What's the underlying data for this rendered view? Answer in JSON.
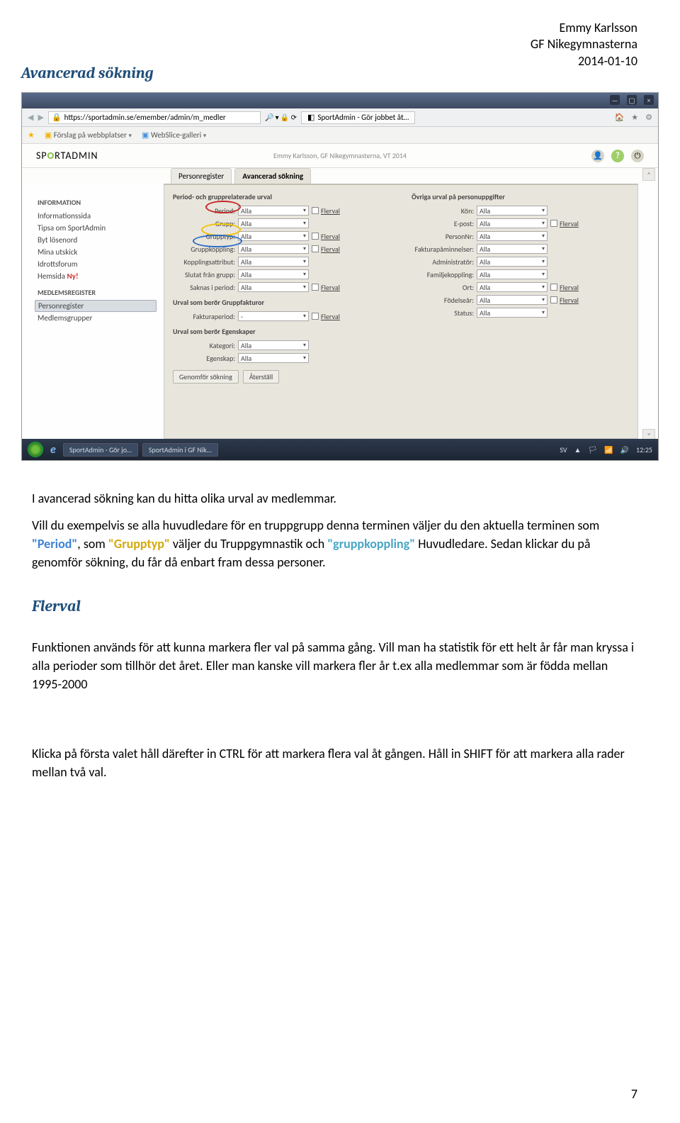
{
  "header": {
    "name": "Emmy Karlsson",
    "org": "GF Nikegymnasterna",
    "date": "2014-01-10"
  },
  "title": "Avancerad sökning",
  "screenshot": {
    "window": {
      "min": "—",
      "max": "▢",
      "close": "×"
    },
    "address": {
      "url": "https://sportadmin.se/emember/admin/m_medler",
      "search_icon": "🔍",
      "lock": "🔒",
      "tab_title": "SportAdmin - Gör jobbet åt…"
    },
    "header_icons": {
      "home": "🏠",
      "star": "★",
      "gear": "⚙"
    },
    "favorites": {
      "star": "★",
      "item1": "Förslag på webbplatser",
      "item2": "WebSlice-galleri",
      "chev": "▾"
    },
    "logo": {
      "a": "SP",
      "b": "O",
      "c": "RTADMIN"
    },
    "breadcrumb": "Emmy Karlsson, GF Nikegymnasterna, VT 2014",
    "app_icons": {
      "user": "👤",
      "help": "?",
      "power": "⏻"
    },
    "app_tabs": {
      "t1": "Personregister",
      "t2": "Avancerad sökning"
    },
    "sidebar": {
      "head1": "INFORMATION",
      "info1": "Informationssida",
      "info2": "Tipsa om SportAdmin",
      "info3": "Byt lösenord",
      "info4": "Mina utskick",
      "info5": "Idrottsforum",
      "info6": "Hemsida",
      "info6new": "Ny!",
      "head2": "MEDLEMSREGISTER",
      "med1": "Personregister",
      "med2": "Medlemsgrupper"
    },
    "form": {
      "sec1": "Period- och grupprelaterade urval",
      "sec2": "Övriga urval på personuppgifter",
      "sec3": "Urval som berör Gruppfakturor",
      "sec4": "Urval som berör Egenskaper",
      "all": "Alla",
      "dash": "-",
      "dd": "▾",
      "flerval": "Flerval",
      "l_period": "Period:",
      "l_grupp": "Grupp:",
      "l_grupptyp": "Grupptyp:",
      "l_gruppkoppling": "Gruppkoppling:",
      "l_kopplingsattribut": "Kopplingsattribut:",
      "l_slutat": "Slutat från grupp:",
      "l_saknas": "Saknas i period:",
      "l_fakturaperiod": "Fakturaperiod:",
      "l_kategori": "Kategori:",
      "l_egenskap": "Egenskap:",
      "l_kon": "Kön:",
      "l_epost": "E-post:",
      "l_personnr": "PersonNr:",
      "l_fakturapam": "Fakturapåminnelser:",
      "l_admin": "Administratör:",
      "l_familj": "Familjekoppling:",
      "l_ort": "Ort:",
      "l_fodelsear": "Födelseår:",
      "l_status": "Status:",
      "btn1": "Genomför sökning",
      "btn2": "Återställ"
    },
    "taskbar": {
      "ie": "e",
      "t1": "SportAdmin - Gör jo…",
      "t2": "SportAdmin i GF Nik…",
      "lang": "SV",
      "up": "▲",
      "flag": "🏳",
      "wifi": "📶",
      "vol": "🔊",
      "time": "12:25"
    }
  },
  "body": {
    "p1a": "I avancerad sökning kan du hitta olika urval av medlemmar.",
    "p1b_a": "Vill du exempelvis se alla huvudledare för en truppgrupp denna terminen väljer du den aktuella terminen som ",
    "p1b_period": "\"Period\"",
    "p1b_b": ", som ",
    "p1b_grupptyp": "\"Grupptyp\"",
    "p1b_c": " väljer du Truppgymnastik och ",
    "p1b_gruppkoppling": "\"gruppkoppling\"",
    "p1b_d": " Huvudledare. Sedan klickar du på genomför sökning, du får då enbart fram dessa personer.",
    "flerval_h": "Flerval",
    "p2": "Funktionen används för att kunna markera fler val på samma gång. Vill man ha statistik för ett helt år får man kryssa i alla perioder som tillhör det året. Eller man kanske vill markera fler år t.ex alla medlemmar som är födda mellan 1995-2000",
    "p3": "Klicka på första valet håll därefter in CTRL för att markera flera val åt gången. Håll in SHIFT för att markera alla rader mellan två val."
  },
  "page_num": "7"
}
